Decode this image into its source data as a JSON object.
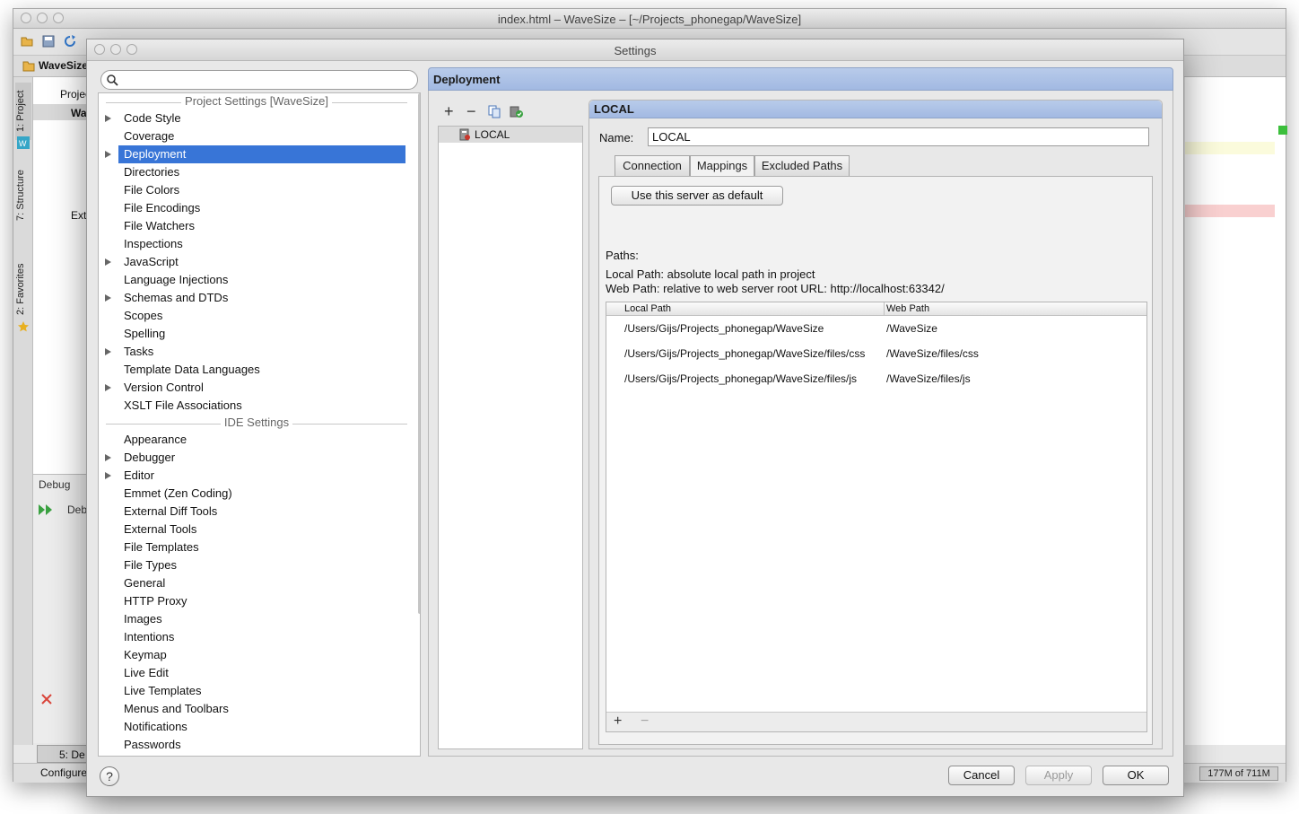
{
  "main_window": {
    "title": "index.html – WaveSize – [~/Projects_phonegap/WaveSize]",
    "project_tab": "WaveSize",
    "tool_tabs": [
      "1: Project",
      "7: Structure",
      "2: Favorites"
    ],
    "project_tree_items": [
      "Projec",
      "Wa",
      "Ext"
    ],
    "debug_label": "Debug",
    "debug_tab": "Deb",
    "bottom_tab": "5: De",
    "status_text": "Configure",
    "memory": "177M of 711M",
    "colors": {
      "selection": "#3875d7",
      "header": "#a2b9e2"
    }
  },
  "dialog": {
    "title": "Settings",
    "search": {
      "value": "",
      "placeholder": ""
    },
    "tree": {
      "project_header": "Project Settings [WaveSize]",
      "project_items": [
        {
          "label": "Code Style",
          "expandable": true
        },
        {
          "label": "Coverage",
          "expandable": false
        },
        {
          "label": "Deployment",
          "expandable": true,
          "selected": true
        },
        {
          "label": "Directories",
          "expandable": false
        },
        {
          "label": "File Colors",
          "expandable": false
        },
        {
          "label": "File Encodings",
          "expandable": false
        },
        {
          "label": "File Watchers",
          "expandable": false
        },
        {
          "label": "Inspections",
          "expandable": false
        },
        {
          "label": "JavaScript",
          "expandable": true
        },
        {
          "label": "Language Injections",
          "expandable": false
        },
        {
          "label": "Schemas and DTDs",
          "expandable": true
        },
        {
          "label": "Scopes",
          "expandable": false
        },
        {
          "label": "Spelling",
          "expandable": false
        },
        {
          "label": "Tasks",
          "expandable": true
        },
        {
          "label": "Template Data Languages",
          "expandable": false
        },
        {
          "label": "Version Control",
          "expandable": true
        },
        {
          "label": "XSLT File Associations",
          "expandable": false
        }
      ],
      "ide_header": "IDE Settings",
      "ide_items": [
        {
          "label": "Appearance",
          "expandable": false
        },
        {
          "label": "Debugger",
          "expandable": true
        },
        {
          "label": "Editor",
          "expandable": true
        },
        {
          "label": "Emmet (Zen Coding)",
          "expandable": false
        },
        {
          "label": "External Diff Tools",
          "expandable": false
        },
        {
          "label": "External Tools",
          "expandable": false
        },
        {
          "label": "File Templates",
          "expandable": false
        },
        {
          "label": "File Types",
          "expandable": false
        },
        {
          "label": "General",
          "expandable": false
        },
        {
          "label": "HTTP Proxy",
          "expandable": false
        },
        {
          "label": "Images",
          "expandable": false
        },
        {
          "label": "Intentions",
          "expandable": false
        },
        {
          "label": "Keymap",
          "expandable": false
        },
        {
          "label": "Live Edit",
          "expandable": false
        },
        {
          "label": "Live Templates",
          "expandable": false
        },
        {
          "label": "Menus and Toolbars",
          "expandable": false
        },
        {
          "label": "Notifications",
          "expandable": false
        },
        {
          "label": "Passwords",
          "expandable": false
        }
      ]
    },
    "deployment": {
      "title": "Deployment",
      "toolbar": {
        "add": "+",
        "remove": "−"
      },
      "servers": [
        "LOCAL"
      ],
      "server": {
        "header": "LOCAL",
        "name_label": "Name:",
        "name_value": "LOCAL",
        "tabs": [
          "Connection",
          "Mappings",
          "Excluded Paths"
        ],
        "active_tab": "Mappings",
        "default_button": "Use this server as default",
        "paths_label": "Paths:",
        "local_path_desc": "Local Path: absolute local path in project",
        "web_path_desc": "Web Path: relative to web server root URL: http://localhost:63342/",
        "table": {
          "columns": [
            "Local Path",
            "Web Path"
          ],
          "rows": [
            [
              "/Users/Gijs/Projects_phonegap/WaveSize",
              "/WaveSize"
            ],
            [
              "/Users/Gijs/Projects_phonegap/WaveSize/files/css",
              "/WaveSize/files/css"
            ],
            [
              "/Users/Gijs/Projects_phonegap/WaveSize/files/js",
              "/WaveSize/files/js"
            ]
          ],
          "add": "+",
          "remove": "−"
        }
      }
    },
    "buttons": {
      "help": "?",
      "cancel": "Cancel",
      "apply": "Apply",
      "ok": "OK"
    }
  }
}
